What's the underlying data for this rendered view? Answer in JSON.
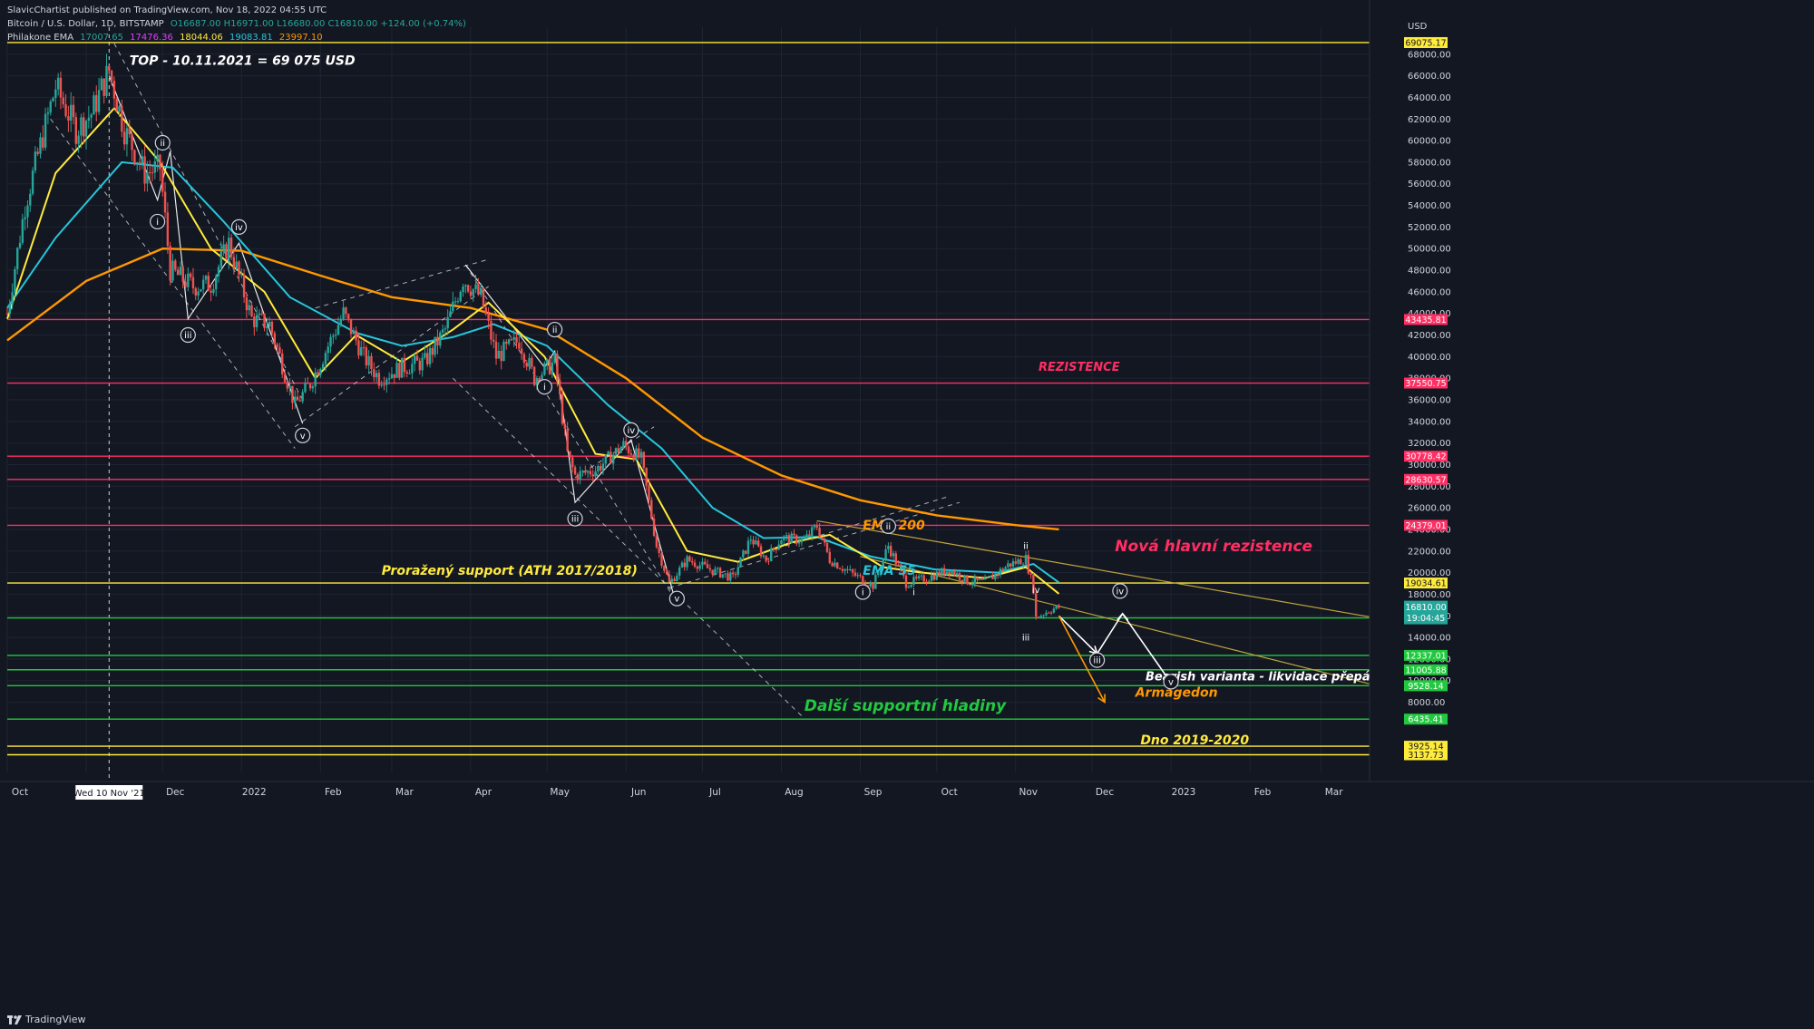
{
  "header": {
    "published": "SlavicChartist published on TradingView.com, Nov 18, 2022 04:55 UTC",
    "symbol": "Bitcoin / U.S. Dollar, 1D, BITSTAMP",
    "ohlc": "O16687.00 H16971.00 L16680.00 C16810.00 +124.00 (+0.74%)",
    "indicator": "Philakone EMA",
    "ema_values": [
      "17007.65",
      "17476.36",
      "18044.06",
      "19083.81",
      "23997.10"
    ],
    "ema_colors": [
      "#26a69a",
      "#e040fb",
      "#ffeb3b",
      "#26c6da",
      "#ff9800"
    ]
  },
  "footer": {
    "brand": "TradingView",
    "logo": "tradingview-logo-icon"
  },
  "colors": {
    "background": "#131722",
    "grid": "#1f2433",
    "axis_text": "#d1d4dc",
    "candle_up": "#26a69a",
    "candle_down": "#ef5350",
    "ema200": "#ff9800",
    "ema55": "#26c6da",
    "ema21": "#ffeb3b",
    "ema13": "#e040fb",
    "ema8": "#26a69a",
    "red_level": "#ff2e63",
    "yellow_level": "#ffeb3b",
    "green_level": "#21c93f",
    "current_price": "#26a69a"
  },
  "chart_data": {
    "type": "candlestick",
    "title": "",
    "yscale": "linear",
    "ylim": [
      1500,
      70500
    ],
    "x_range": [
      "2021-10-01",
      "2023-03-20"
    ],
    "x_ticks": [
      "Oct",
      "Nov",
      "Dec",
      "2022",
      "Feb",
      "Mar",
      "Apr",
      "May",
      "Jun",
      "Jul",
      "Aug",
      "Sep",
      "Oct",
      "Nov",
      "Dec",
      "2023",
      "Feb",
      "Mar"
    ],
    "x_tick_dates": [
      "2021-10-01",
      "2021-11-01",
      "2021-12-01",
      "2022-01-01",
      "2022-02-01",
      "2022-03-01",
      "2022-04-01",
      "2022-05-01",
      "2022-06-01",
      "2022-07-01",
      "2022-08-01",
      "2022-09-01",
      "2022-10-01",
      "2022-11-01",
      "2022-12-01",
      "2023-01-01",
      "2023-02-01",
      "2023-03-01"
    ],
    "crosshair_label": "Wed 10 Nov '21",
    "crosshair_date": "2021-11-10",
    "y_unit": "USD",
    "y_ticks": [
      "8000.00",
      "10000.00",
      "12000.00",
      "14000.00",
      "16000.00",
      "18000.00",
      "20000.00",
      "22000.00",
      "24000.00",
      "26000.00",
      "28000.00",
      "30000.00",
      "32000.00",
      "34000.00",
      "36000.00",
      "38000.00",
      "40000.00",
      "42000.00",
      "44000.00",
      "46000.00",
      "48000.00",
      "50000.00",
      "52000.00",
      "54000.00",
      "56000.00",
      "58000.00",
      "60000.00",
      "62000.00",
      "64000.00",
      "66000.00",
      "68000.00"
    ],
    "price_series": [
      [
        "2021-10-01",
        44000
      ],
      [
        "2021-10-08",
        54000
      ],
      [
        "2021-10-15",
        60500
      ],
      [
        "2021-10-20",
        65000
      ],
      [
        "2021-10-28",
        61000
      ],
      [
        "2021-11-03",
        62500
      ],
      [
        "2021-11-10",
        66500
      ],
      [
        "2021-11-16",
        61000
      ],
      [
        "2021-11-24",
        57000
      ],
      [
        "2021-11-30",
        57500
      ],
      [
        "2021-12-04",
        48000
      ],
      [
        "2021-12-13",
        46500
      ],
      [
        "2021-12-20",
        46700
      ],
      [
        "2021-12-27",
        50500
      ],
      [
        "2022-01-05",
        43500
      ],
      [
        "2022-01-12",
        43000
      ],
      [
        "2022-01-22",
        35500
      ],
      [
        "2022-01-28",
        37500
      ],
      [
        "2022-02-05",
        41500
      ],
      [
        "2022-02-10",
        44000
      ],
      [
        "2022-02-18",
        40000
      ],
      [
        "2022-02-24",
        38000
      ],
      [
        "2022-03-05",
        39000
      ],
      [
        "2022-03-14",
        39500
      ],
      [
        "2022-03-22",
        42500
      ],
      [
        "2022-03-29",
        47200
      ],
      [
        "2022-04-05",
        45500
      ],
      [
        "2022-04-11",
        40000
      ],
      [
        "2022-04-20",
        41500
      ],
      [
        "2022-04-26",
        38000
      ],
      [
        "2022-05-04",
        39500
      ],
      [
        "2022-05-09",
        31000
      ],
      [
        "2022-05-12",
        29000
      ],
      [
        "2022-05-20",
        29500
      ],
      [
        "2022-05-31",
        31800
      ],
      [
        "2022-06-07",
        30500
      ],
      [
        "2022-06-13",
        22500
      ],
      [
        "2022-06-18",
        19000
      ],
      [
        "2022-06-25",
        21200
      ],
      [
        "2022-07-05",
        20200
      ],
      [
        "2022-07-13",
        19500
      ],
      [
        "2022-07-20",
        23200
      ],
      [
        "2022-07-26",
        21200
      ],
      [
        "2022-08-01",
        23200
      ],
      [
        "2022-08-10",
        23000
      ],
      [
        "2022-08-15",
        24300
      ],
      [
        "2022-08-20",
        21200
      ],
      [
        "2022-08-28",
        20000
      ],
      [
        "2022-09-06",
        18800
      ],
      [
        "2022-09-12",
        22500
      ],
      [
        "2022-09-19",
        19000
      ],
      [
        "2022-09-27",
        19500
      ],
      [
        "2022-10-06",
        20300
      ],
      [
        "2022-10-13",
        19200
      ],
      [
        "2022-10-20",
        19100
      ],
      [
        "2022-10-29",
        20700
      ],
      [
        "2022-11-05",
        21300
      ],
      [
        "2022-11-08",
        18500
      ],
      [
        "2022-11-09",
        15800
      ],
      [
        "2022-11-14",
        16500
      ],
      [
        "2022-11-18",
        16810
      ]
    ],
    "moving_averages": [
      {
        "name": "EMA 200",
        "color": "#ff9800",
        "points": [
          [
            "2021-10-01",
            41500
          ],
          [
            "2021-11-01",
            47000
          ],
          [
            "2021-12-01",
            50000
          ],
          [
            "2022-01-01",
            49800
          ],
          [
            "2022-02-01",
            47500
          ],
          [
            "2022-03-01",
            45500
          ],
          [
            "2022-04-01",
            44500
          ],
          [
            "2022-05-01",
            42500
          ],
          [
            "2022-06-01",
            38000
          ],
          [
            "2022-07-01",
            32500
          ],
          [
            "2022-08-01",
            29000
          ],
          [
            "2022-09-01",
            26700
          ],
          [
            "2022-10-01",
            25300
          ],
          [
            "2022-11-01",
            24400
          ],
          [
            "2022-11-18",
            23997
          ]
        ]
      },
      {
        "name": "EMA 55",
        "color": "#26c6da",
        "points": [
          [
            "2021-10-01",
            44500
          ],
          [
            "2021-10-20",
            51000
          ],
          [
            "2021-11-15",
            58000
          ],
          [
            "2021-12-05",
            57500
          ],
          [
            "2021-12-25",
            52500
          ],
          [
            "2022-01-20",
            45500
          ],
          [
            "2022-02-15",
            42200
          ],
          [
            "2022-03-05",
            41000
          ],
          [
            "2022-03-25",
            41800
          ],
          [
            "2022-04-10",
            43000
          ],
          [
            "2022-05-01",
            41000
          ],
          [
            "2022-05-25",
            35500
          ],
          [
            "2022-06-15",
            31500
          ],
          [
            "2022-07-05",
            26000
          ],
          [
            "2022-07-25",
            23200
          ],
          [
            "2022-08-15",
            23300
          ],
          [
            "2022-09-05",
            21500
          ],
          [
            "2022-09-30",
            20300
          ],
          [
            "2022-10-25",
            20000
          ],
          [
            "2022-11-08",
            20800
          ],
          [
            "2022-11-18",
            19084
          ]
        ]
      },
      {
        "name": "EMA 21",
        "color": "#ffeb3b",
        "points": [
          [
            "2021-10-01",
            43500
          ],
          [
            "2021-10-20",
            57000
          ],
          [
            "2021-11-12",
            63000
          ],
          [
            "2021-11-30",
            58000
          ],
          [
            "2021-12-20",
            50000
          ],
          [
            "2022-01-10",
            46000
          ],
          [
            "2022-01-30",
            38000
          ],
          [
            "2022-02-15",
            42000
          ],
          [
            "2022-03-05",
            39500
          ],
          [
            "2022-03-25",
            42500
          ],
          [
            "2022-04-08",
            45000
          ],
          [
            "2022-04-30",
            40000
          ],
          [
            "2022-05-20",
            31000
          ],
          [
            "2022-06-05",
            30500
          ],
          [
            "2022-06-25",
            22000
          ],
          [
            "2022-07-15",
            21000
          ],
          [
            "2022-08-05",
            22800
          ],
          [
            "2022-08-20",
            23500
          ],
          [
            "2022-09-10",
            20500
          ],
          [
            "2022-09-25",
            20000
          ],
          [
            "2022-10-20",
            19500
          ],
          [
            "2022-11-05",
            20500
          ],
          [
            "2022-11-18",
            18044
          ]
        ]
      }
    ],
    "horizontal_levels": [
      {
        "price": "69075.17",
        "value": 69075.17,
        "color": "#ffeb3b"
      },
      {
        "price": "43435.81",
        "value": 43435.81,
        "color": "#ff2e63"
      },
      {
        "price": "37550.75",
        "value": 37550.75,
        "color": "#ff2e63"
      },
      {
        "price": "30778.42",
        "value": 30778.42,
        "color": "#ff2e63"
      },
      {
        "price": "28630.57",
        "value": 28630.57,
        "color": "#ff2e63"
      },
      {
        "price": "24379.01",
        "value": 24379.01,
        "color": "#ff2e63"
      },
      {
        "price": "19034.61",
        "value": 19034.61,
        "color": "#ffeb3b"
      },
      {
        "price": "15808.02",
        "value": 15808.02,
        "color": "#21c93f"
      },
      {
        "price": "12337.01",
        "value": 12337.01,
        "color": "#21c93f"
      },
      {
        "price": "11005.88",
        "value": 11005.88,
        "color": "#21c93f"
      },
      {
        "price": "9528.14",
        "value": 9528.14,
        "color": "#21c93f"
      },
      {
        "price": "6435.41",
        "value": 6435.41,
        "color": "#21c93f"
      },
      {
        "price": "3925.14",
        "value": 3925.14,
        "color": "#ffeb3b"
      },
      {
        "price": "3137.73",
        "value": 3137.73,
        "color": "#ffeb3b"
      }
    ],
    "current_price": {
      "price": "16810.00",
      "countdown": "19:04:45",
      "value": 16810
    },
    "annotations": [
      {
        "text": "TOP - 10.11.2021 = 69 075 USD",
        "color": "#ffffff",
        "date": "2021-11-18",
        "price": 67000
      },
      {
        "text": "REZISTENCE",
        "color": "#ff2e63",
        "date": "2022-11-10",
        "price": 38700
      },
      {
        "text": "EMA 200",
        "color": "#ff9800",
        "date": "2022-09-02",
        "price": 24000
      },
      {
        "text": "Nová hlavní rezistence",
        "color": "#ff2e63",
        "date": "2022-12-10",
        "price": 22000
      },
      {
        "text": "EMA 55",
        "color": "#26c6da",
        "date": "2022-09-02",
        "price": 19800
      },
      {
        "text": "Proražený support (ATH 2017/2018)",
        "color": "#ffeb3b",
        "date": "2022-02-25",
        "price": 19800
      },
      {
        "text": "Bearish varianta - likvidace přepákovaných longů",
        "color": "#ffffff",
        "date": "2022-12-22",
        "price": 10000
      },
      {
        "text": "Armagedon",
        "color": "#ff9800",
        "date": "2022-12-18",
        "price": 8500
      },
      {
        "text": "Další supportní hladiny",
        "color": "#21c93f",
        "date": "2022-08-10",
        "price": 7200
      },
      {
        "text": "Dno 2019-2020",
        "color": "#ffeb3b",
        "date": "2022-12-20",
        "price": 4100
      }
    ],
    "wave_labels": [
      {
        "text": "ii",
        "circled": true,
        "date": "2021-12-01",
        "price": 59800
      },
      {
        "text": "i",
        "circled": true,
        "date": "2021-11-29",
        "price": 52500
      },
      {
        "text": "iv",
        "circled": true,
        "date": "2021-12-31",
        "price": 52000
      },
      {
        "text": "iii",
        "circled": true,
        "date": "2021-12-11",
        "price": 42000
      },
      {
        "text": "v",
        "circled": true,
        "date": "2022-01-25",
        "price": 32700
      },
      {
        "text": "ii",
        "circled": true,
        "date": "2022-05-04",
        "price": 42500
      },
      {
        "text": "i",
        "circled": true,
        "date": "2022-04-30",
        "price": 37200
      },
      {
        "text": "iv",
        "circled": true,
        "date": "2022-06-03",
        "price": 33200
      },
      {
        "text": "iii",
        "circled": true,
        "date": "2022-05-12",
        "price": 25000
      },
      {
        "text": "v",
        "circled": true,
        "date": "2022-06-21",
        "price": 17600
      },
      {
        "text": "ii",
        "circled": true,
        "date": "2022-09-12",
        "price": 24300
      },
      {
        "text": "i",
        "circled": true,
        "date": "2022-09-02",
        "price": 18200
      },
      {
        "text": "i",
        "circled": false,
        "date": "2022-09-22",
        "price": 18200
      },
      {
        "text": "ii",
        "circled": false,
        "date": "2022-11-05",
        "price": 22500
      },
      {
        "text": "iv",
        "circled": false,
        "date": "2022-11-09",
        "price": 18400
      },
      {
        "text": "iii",
        "circled": false,
        "date": "2022-11-05",
        "price": 14000
      },
      {
        "text": "iv",
        "circled": true,
        "date": "2022-12-12",
        "price": 18300
      },
      {
        "text": "iii",
        "circled": true,
        "date": "2022-12-03",
        "price": 11900
      },
      {
        "text": "v",
        "circled": true,
        "date": "2023-01-01",
        "price": 9900
      }
    ]
  }
}
